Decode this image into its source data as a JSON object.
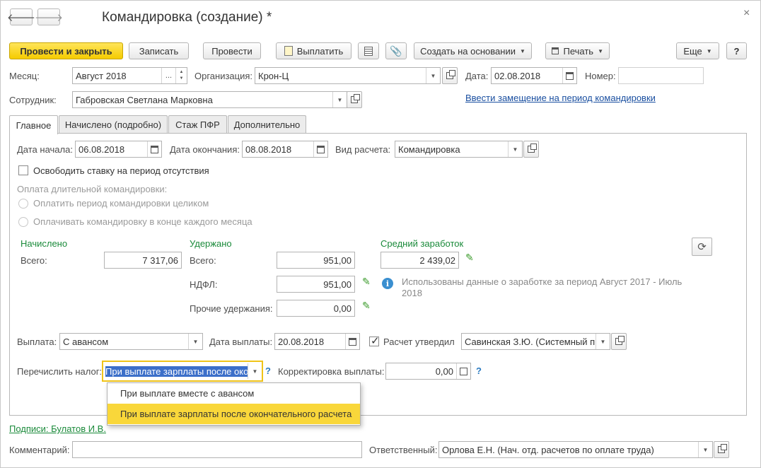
{
  "window": {
    "title": "Командировка (создание) *",
    "back_glyph": "🡐",
    "forward_glyph": "🡒",
    "close_glyph": "×"
  },
  "toolbar": {
    "post_close": "Провести и закрыть",
    "save": "Записать",
    "post": "Провести",
    "pay": "Выплатить",
    "create_based": "Создать на основании",
    "print": "Печать",
    "more": "Еще",
    "help": "?"
  },
  "header": {
    "month_label": "Месяц:",
    "month_value": "Август 2018",
    "month_dots": "...",
    "org_label": "Организация:",
    "org_value": "Крон-Ц",
    "date_label": "Дата:",
    "date_value": "02.08.2018",
    "number_label": "Номер:",
    "number_value": "",
    "employee_label": "Сотрудник:",
    "employee_value": "Габровская Светлана Марковна",
    "replacement_link": "Ввести замещение на период командировки"
  },
  "tabs": [
    {
      "label": "Главное"
    },
    {
      "label": "Начислено (подробно)"
    },
    {
      "label": "Стаж ПФР"
    },
    {
      "label": "Дополнительно"
    }
  ],
  "main": {
    "start_label": "Дата начала:",
    "start_value": "06.08.2018",
    "end_label": "Дата окончания:",
    "end_value": "08.08.2018",
    "calc_type_label": "Вид расчета:",
    "calc_type_value": "Командировка",
    "free_rate_label": "Освободить ставку на период отсутствия",
    "long_trip_label": "Оплата длительной командировки:",
    "radio_whole": "Оплатить период командировки целиком",
    "radio_monthly": "Оплачивать командировку в конце каждого месяца",
    "accrued_header": "Начислено",
    "withheld_header": "Удержано",
    "avg_header": "Средний заработок",
    "total_label": "Всего:",
    "accrued_total": "7 317,06",
    "withheld_total_label": "Всего:",
    "withheld_total": "951,00",
    "ndfl_label": "НДФЛ:",
    "ndfl_value": "951,00",
    "other_label": "Прочие удержания:",
    "other_value": "0,00",
    "avg_value": "2 439,02",
    "info_text_1": "Использованы данные о заработке за период Август 2017 - Июль",
    "info_text_2": "2018",
    "payment_label": "Выплата:",
    "payment_value": "С авансом",
    "pay_date_label": "Дата выплаты:",
    "pay_date_value": "20.08.2018",
    "approved_label": "Расчет утвердил",
    "approved_value": "Савинская З.Ю. (Системный п",
    "tax_label": "Перечислить налог:",
    "tax_value": "При выплате зарплаты после око",
    "correction_label": "Корректировка выплаты:",
    "correction_value": "0,00",
    "q": "?"
  },
  "dropdown": {
    "options": [
      "При выплате вместе с авансом",
      "При выплате зарплаты после окончательного расчета"
    ]
  },
  "footer": {
    "signatures_link": "Подписи: Булатов И.В.",
    "comment_label": "Комментарий:",
    "comment_value": "",
    "responsible_label": "Ответственный:",
    "responsible_value": "Орлова Е.Н. (Нач. отд. расчетов по оплате труда)"
  },
  "icons": {
    "pencil": "✎",
    "info": "i",
    "refresh": "⟳",
    "caret": "▼",
    "spin_up": "▲",
    "spin_down": "▼"
  },
  "colors": {
    "primary_button": "#f5cb00",
    "link_blue": "#1a4fa0",
    "green_header": "#1a8a3a",
    "dropdown_highlight": "#f9d73a",
    "selection_blue": "#3c6fc9"
  }
}
